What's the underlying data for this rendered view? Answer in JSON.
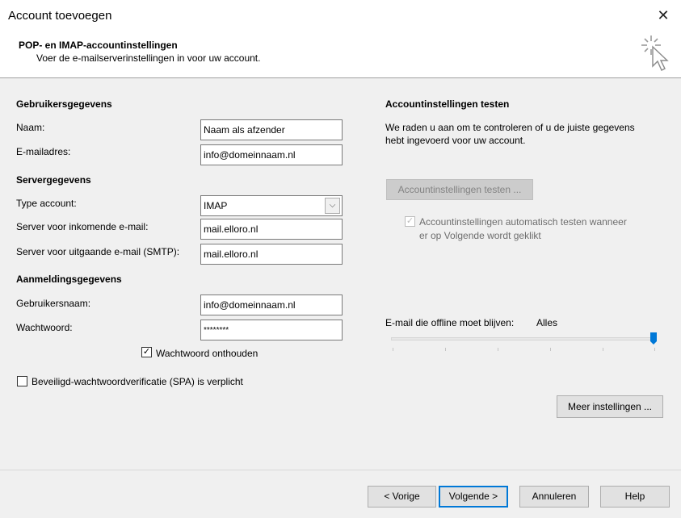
{
  "window": {
    "title": "Account toevoegen",
    "close_symbol": "✕"
  },
  "header": {
    "title": "POP- en IMAP-accountinstellingen",
    "subtitle": "Voer de e-mailserverinstellingen in voor uw account."
  },
  "user_info": {
    "heading": "Gebruikersgegevens",
    "name_label": "Naam:",
    "name_value": "Naam als afzender",
    "email_label": "E-mailadres:",
    "email_value": "info@domeinnaam.nl"
  },
  "server_info": {
    "heading": "Servergegevens",
    "type_label": "Type account:",
    "type_value": "IMAP",
    "incoming_label": "Server voor inkomende e-mail:",
    "incoming_value": "mail.elloro.nl",
    "outgoing_label": "Server voor uitgaande e-mail (SMTP):",
    "outgoing_value": "mail.elloro.nl"
  },
  "login_info": {
    "heading": "Aanmeldingsgegevens",
    "username_label": "Gebruikersnaam:",
    "username_value": "info@domeinnaam.nl",
    "password_label": "Wachtwoord:",
    "password_value": "********",
    "remember_label": "Wachtwoord onthouden",
    "remember_checked": true,
    "spa_label": "Beveiligd-wachtwoordverificatie (SPA) is verplicht",
    "spa_checked": false
  },
  "test_settings": {
    "heading": "Accountinstellingen testen",
    "description_line1": "We raden u aan om te controleren of u de juiste gegevens",
    "description_line2": "hebt ingevoerd voor uw account.",
    "test_button": "Accountinstellingen testen ...",
    "auto_test_line1": "Accountinstellingen automatisch testen wanneer",
    "auto_test_line2": "er op Volgende wordt geklikt",
    "auto_test_checked": true
  },
  "offline": {
    "label": "E-mail die offline moet blijven:",
    "value": "Alles",
    "slider_level": 1.0
  },
  "more_settings_button": "Meer instellingen ...",
  "footer": {
    "back": "< Vorige",
    "next": "Volgende >",
    "cancel": "Annuleren",
    "help": "Help"
  },
  "colors": {
    "accent": "#0078d7",
    "slider_thumb": "#0078d7"
  }
}
